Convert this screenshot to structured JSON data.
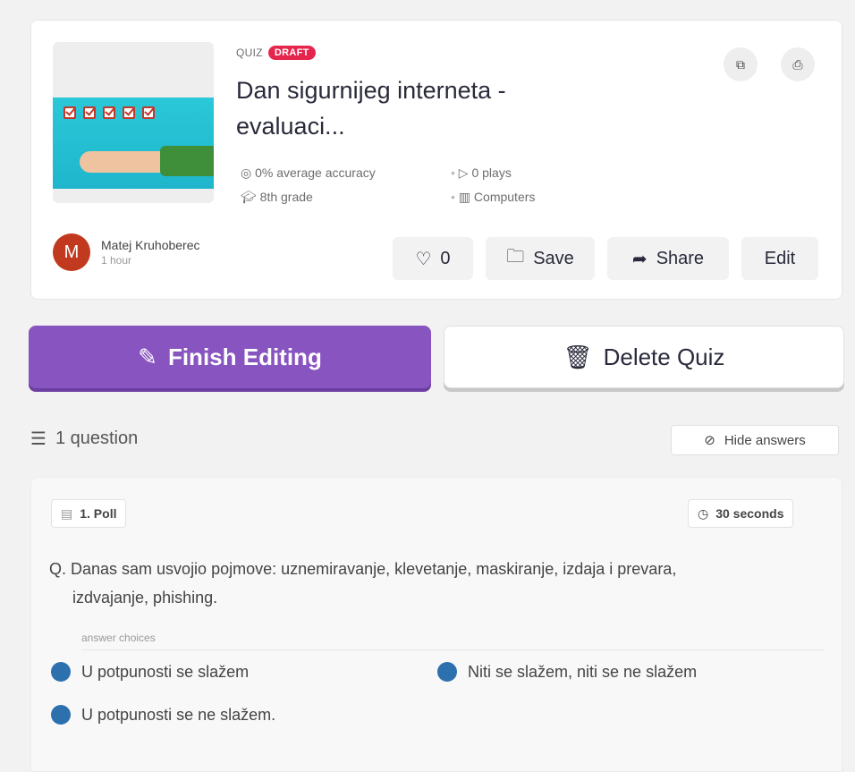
{
  "quiz": {
    "type_label": "QUIZ",
    "status_badge": "DRAFT",
    "title_line1": "Dan sigurnijeg interneta -",
    "title_line2": "evaluaci...",
    "accuracy": "0% average accuracy",
    "plays": "0 plays",
    "grade": "8th grade",
    "subject": "Computers"
  },
  "author": {
    "initial": "M",
    "name": "Matej Kruhoberec",
    "time": "1 hour"
  },
  "actions": {
    "like_count": "0",
    "save_label": "Save",
    "share_label": "Share",
    "edit_label": "Edit"
  },
  "buttons": {
    "finish_label": "Finish Editing",
    "delete_label": "Delete Quiz"
  },
  "questions_section": {
    "count_label": "1 question",
    "hide_answers_label": "Hide answers"
  },
  "question": {
    "number_type": "1. Poll",
    "time": "30 seconds",
    "text_line1": "Q. Danas sam usvojio pojmove: uznemiravanje, klevetanje, maskiranje, izdaja i prevara,",
    "text_line2": "izdvajanje, phishing.",
    "answers_label": "answer choices",
    "choices": [
      "U potpunosti se slažem",
      "Niti se slažem, niti se ne slažem",
      "U potpunosti se ne slažem."
    ]
  },
  "colors": {
    "accent_purple": "#8854c0",
    "draft_red": "#e5254c",
    "choice_blue": "#2d70ae",
    "avatar_red": "#c1391e"
  }
}
